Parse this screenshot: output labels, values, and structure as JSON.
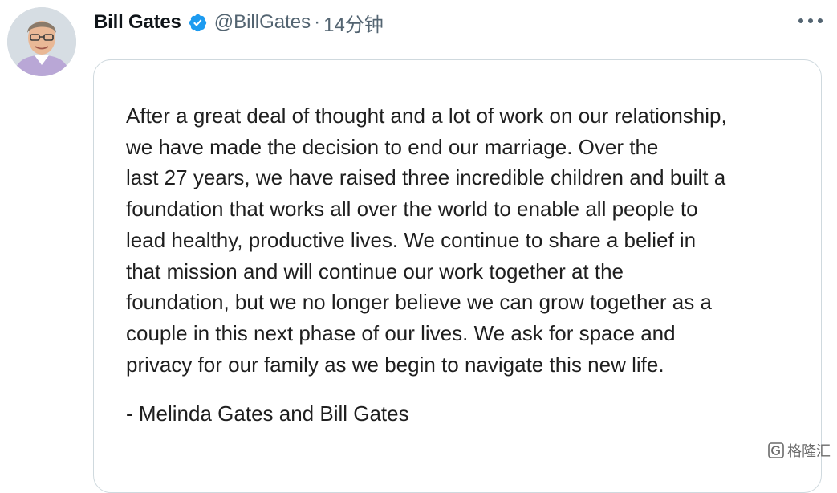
{
  "tweet": {
    "display_name": "Bill Gates",
    "handle": "@BillGates",
    "separator": "·",
    "time": "14分钟",
    "verified_color": "#1d9bf0",
    "avatar_icon": "user-avatar-photo",
    "more_icon": "more-horizontal-icon"
  },
  "statement": {
    "lines": [
      "After a great deal of thought and a lot of work on our relationship,",
      "we have made the decision to end our marriage. Over the",
      "last 27 years, we have raised three incredible children and built a",
      "foundation that works all over the world to enable all people to",
      "lead healthy, productive lives. We continue to share a belief in",
      "that mission and will continue our work together at the",
      "foundation, but we no longer believe we can grow together as a",
      "couple in this next phase of our lives. We ask for space and",
      "privacy for our family as we begin to navigate this new life."
    ],
    "signature": "- Melinda Gates and Bill Gates"
  },
  "watermark": {
    "text": "格隆汇",
    "icon": "watermark-logo-icon"
  }
}
